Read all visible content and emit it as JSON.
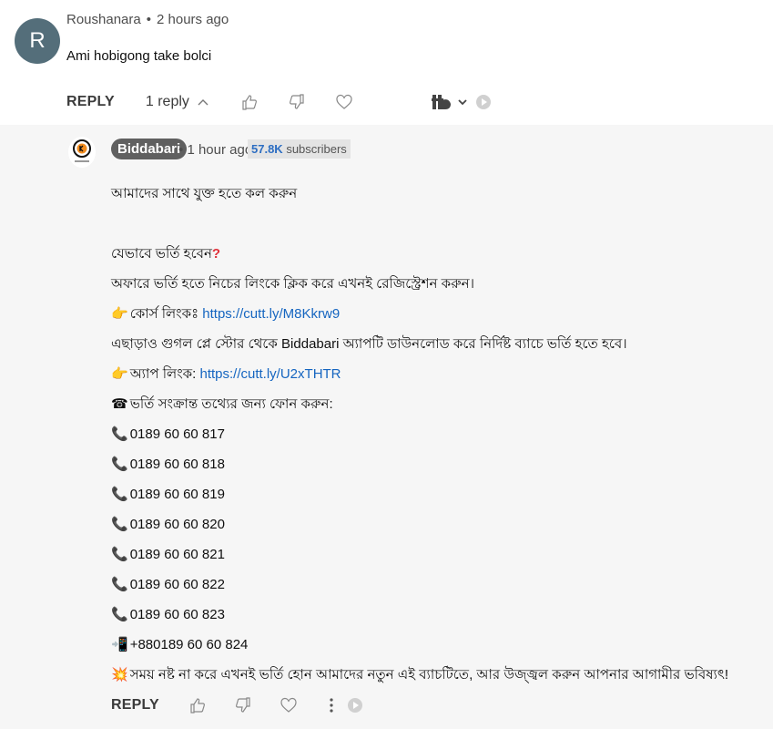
{
  "comment": {
    "avatar_letter": "R",
    "author": "Roushanara",
    "separator": "•",
    "time": "2 hours ago",
    "text": "Ami hobigong take bolci",
    "reply_label": "REPLY",
    "reply_count": "1 reply"
  },
  "reply": {
    "author": "Biddabari",
    "separator": "•",
    "time": "1 hour ago",
    "subscribers_count": "57.8K",
    "subscribers_label": "subscribers",
    "lines": {
      "l1": "আমাদের সাথে যুক্ত হতে কল করুন",
      "l2": "যেভাবে ভর্তি হবেন",
      "l3": "অফারে ভর্তি হতে নিচের লিংকে ক্লিক করে এখনই রেজিস্ট্রেশন করুন।",
      "l4_prefix": "কোর্স লিংকঃ ",
      "l4_link": "https://cutt.ly/M8Kkrw9",
      "l5": "এছাড়াও গুগল প্লে স্টোর থেকে Biddabari অ্যাপটি ডাউনলোড করে নির্দিষ্ট ব্যাচে ভর্তি হতে হবে।",
      "l6_prefix": "অ্যাপ লিংক: ",
      "l6_link": "https://cutt.ly/U2xTHTR",
      "l7": "ভর্তি সংক্রান্ত তথ্যের জন্য ফোন করুন:",
      "phones": [
        "0189 60 60 817",
        "0189 60 60 818",
        "0189 60 60 819",
        "0189 60 60 820",
        "0189 60 60 821",
        "0189 60 60 822",
        "0189 60 60 823"
      ],
      "mobile": "+880189 60 60 824",
      "final": "সময় নষ্ট না করে এখনই ভর্তি হোন আমাদের নতুন এই ব্যাচটিতে, আর উজ্জ্বল করুন আপনার আগামীর ভবিষ্যৎ!"
    },
    "reply_label": "REPLY"
  },
  "colors": {
    "link": "#1565c0",
    "avatar_bg": "#546e7a",
    "reply_bg": "#f6f6f6",
    "subs_count": "#2d6ec2"
  },
  "icons": [
    "chevron-up-icon",
    "thumb-up-icon",
    "thumb-down-icon",
    "heart-icon",
    "tb-extension-icon",
    "chevron-down-icon",
    "play-badge-icon",
    "more-vert-icon"
  ]
}
